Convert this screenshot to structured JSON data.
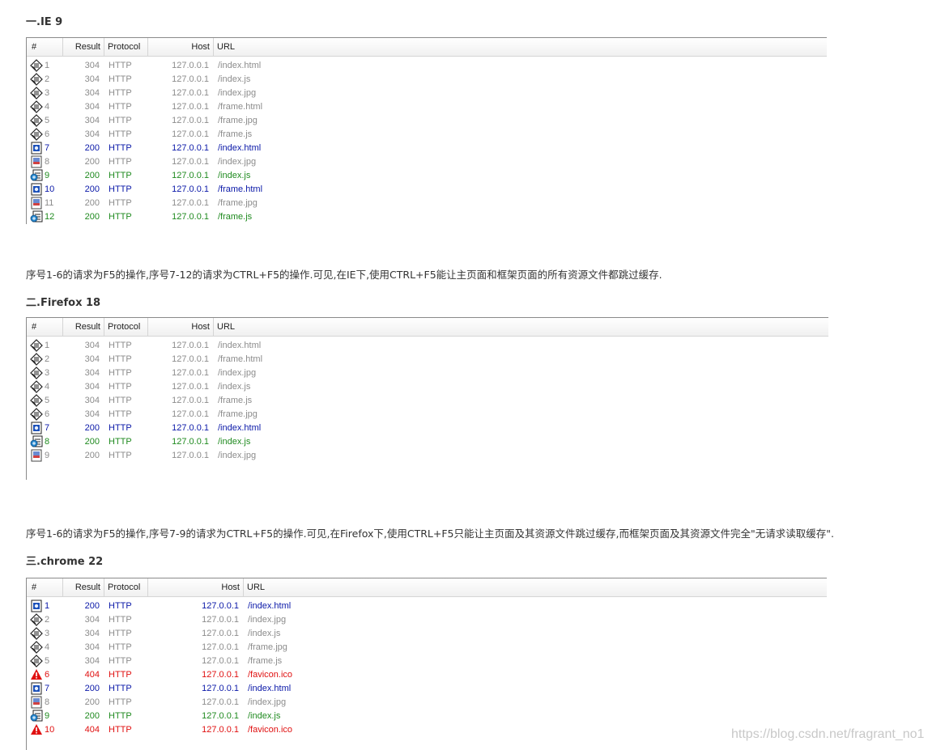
{
  "sections": [
    {
      "heading": "一.IE 9",
      "columns": {
        "num": "#",
        "result": "Result",
        "protocol": "Protocol",
        "host": "Host",
        "url": "URL"
      },
      "rows": [
        {
          "num": "1",
          "result": "304",
          "protocol": "HTTP",
          "host": "127.0.0.1",
          "url": "/index.html",
          "icon": "cache-icon",
          "status": "gray"
        },
        {
          "num": "2",
          "result": "304",
          "protocol": "HTTP",
          "host": "127.0.0.1",
          "url": "/index.js",
          "icon": "cache-icon",
          "status": "gray"
        },
        {
          "num": "3",
          "result": "304",
          "protocol": "HTTP",
          "host": "127.0.0.1",
          "url": "/index.jpg",
          "icon": "cache-icon",
          "status": "gray"
        },
        {
          "num": "4",
          "result": "304",
          "protocol": "HTTP",
          "host": "127.0.0.1",
          "url": "/frame.html",
          "icon": "cache-icon",
          "status": "gray"
        },
        {
          "num": "5",
          "result": "304",
          "protocol": "HTTP",
          "host": "127.0.0.1",
          "url": "/frame.jpg",
          "icon": "cache-icon",
          "status": "gray"
        },
        {
          "num": "6",
          "result": "304",
          "protocol": "HTTP",
          "host": "127.0.0.1",
          "url": "/frame.js",
          "icon": "cache-icon",
          "status": "gray"
        },
        {
          "num": "7",
          "result": "200",
          "protocol": "HTTP",
          "host": "127.0.0.1",
          "url": "/index.html",
          "icon": "html-document-icon",
          "status": "blue"
        },
        {
          "num": "8",
          "result": "200",
          "protocol": "HTTP",
          "host": "127.0.0.1",
          "url": "/index.jpg",
          "icon": "image-file-icon",
          "status": "gray"
        },
        {
          "num": "9",
          "result": "200",
          "protocol": "HTTP",
          "host": "127.0.0.1",
          "url": "/index.js",
          "icon": "script-file-icon",
          "status": "green"
        },
        {
          "num": "10",
          "result": "200",
          "protocol": "HTTP",
          "host": "127.0.0.1",
          "url": "/frame.html",
          "icon": "html-document-icon",
          "status": "blue"
        },
        {
          "num": "11",
          "result": "200",
          "protocol": "HTTP",
          "host": "127.0.0.1",
          "url": "/frame.jpg",
          "icon": "image-file-icon",
          "status": "gray"
        },
        {
          "num": "12",
          "result": "200",
          "protocol": "HTTP",
          "host": "127.0.0.1",
          "url": "/frame.js",
          "icon": "script-file-icon",
          "status": "green"
        }
      ],
      "note": "序号1-6的请求为F5的操作,序号7-12的请求为CTRL+F5的操作.可见,在IE下,使用CTRL+F5能让主页面和框架页面的所有资源文件都跳过缓存."
    },
    {
      "heading": "二.Firefox 18",
      "columns": {
        "num": "#",
        "result": "Result",
        "protocol": "Protocol",
        "host": "Host",
        "url": "URL"
      },
      "rows": [
        {
          "num": "1",
          "result": "304",
          "protocol": "HTTP",
          "host": "127.0.0.1",
          "url": "/index.html",
          "icon": "cache-icon",
          "status": "gray"
        },
        {
          "num": "2",
          "result": "304",
          "protocol": "HTTP",
          "host": "127.0.0.1",
          "url": "/frame.html",
          "icon": "cache-icon",
          "status": "gray"
        },
        {
          "num": "3",
          "result": "304",
          "protocol": "HTTP",
          "host": "127.0.0.1",
          "url": "/index.jpg",
          "icon": "cache-icon",
          "status": "gray"
        },
        {
          "num": "4",
          "result": "304",
          "protocol": "HTTP",
          "host": "127.0.0.1",
          "url": "/index.js",
          "icon": "cache-icon",
          "status": "gray"
        },
        {
          "num": "5",
          "result": "304",
          "protocol": "HTTP",
          "host": "127.0.0.1",
          "url": "/frame.js",
          "icon": "cache-icon",
          "status": "gray"
        },
        {
          "num": "6",
          "result": "304",
          "protocol": "HTTP",
          "host": "127.0.0.1",
          "url": "/frame.jpg",
          "icon": "cache-icon",
          "status": "gray"
        },
        {
          "num": "7",
          "result": "200",
          "protocol": "HTTP",
          "host": "127.0.0.1",
          "url": "/index.html",
          "icon": "html-document-icon",
          "status": "blue"
        },
        {
          "num": "8",
          "result": "200",
          "protocol": "HTTP",
          "host": "127.0.0.1",
          "url": "/index.js",
          "icon": "script-file-icon",
          "status": "green"
        },
        {
          "num": "9",
          "result": "200",
          "protocol": "HTTP",
          "host": "127.0.0.1",
          "url": "/index.jpg",
          "icon": "image-file-icon",
          "status": "gray"
        }
      ],
      "note": "序号1-6的请求为F5的操作,序号7-9的请求为CTRL+F5的操作.可见,在Firefox下,使用CTRL+F5只能让主页面及其资源文件跳过缓存,而框架页面及其资源文件完全\"无请求读取缓存\"."
    },
    {
      "heading": "三.chrome 22",
      "columns": {
        "num": "#",
        "result": "Result",
        "protocol": "Protocol",
        "host": "Host",
        "url": "URL"
      },
      "rows": [
        {
          "num": "1",
          "result": "200",
          "protocol": "HTTP",
          "host": "127.0.0.1",
          "url": "/index.html",
          "icon": "html-document-icon",
          "status": "blue"
        },
        {
          "num": "2",
          "result": "304",
          "protocol": "HTTP",
          "host": "127.0.0.1",
          "url": "/index.jpg",
          "icon": "cache-icon",
          "status": "gray"
        },
        {
          "num": "3",
          "result": "304",
          "protocol": "HTTP",
          "host": "127.0.0.1",
          "url": "/index.js",
          "icon": "cache-icon",
          "status": "gray"
        },
        {
          "num": "4",
          "result": "304",
          "protocol": "HTTP",
          "host": "127.0.0.1",
          "url": "/frame.jpg",
          "icon": "cache-icon",
          "status": "gray"
        },
        {
          "num": "5",
          "result": "304",
          "protocol": "HTTP",
          "host": "127.0.0.1",
          "url": "/frame.js",
          "icon": "cache-icon",
          "status": "gray"
        },
        {
          "num": "6",
          "result": "404",
          "protocol": "HTTP",
          "host": "127.0.0.1",
          "url": "/favicon.ico",
          "icon": "warning-icon",
          "status": "red"
        },
        {
          "num": "7",
          "result": "200",
          "protocol": "HTTP",
          "host": "127.0.0.1",
          "url": "/index.html",
          "icon": "html-document-icon",
          "status": "blue"
        },
        {
          "num": "8",
          "result": "200",
          "protocol": "HTTP",
          "host": "127.0.0.1",
          "url": "/index.jpg",
          "icon": "image-file-icon",
          "status": "gray"
        },
        {
          "num": "9",
          "result": "200",
          "protocol": "HTTP",
          "host": "127.0.0.1",
          "url": "/index.js",
          "icon": "script-file-icon",
          "status": "green"
        },
        {
          "num": "10",
          "result": "404",
          "protocol": "HTTP",
          "host": "127.0.0.1",
          "url": "/favicon.ico",
          "icon": "warning-icon",
          "status": "red"
        }
      ]
    }
  ],
  "watermark": "https://blog.csdn.net/fragrant_no1",
  "colors": {
    "gray": "#8c8c8c",
    "blue": "#0a18a8",
    "green": "#1f8a1f",
    "red": "#e01010"
  }
}
